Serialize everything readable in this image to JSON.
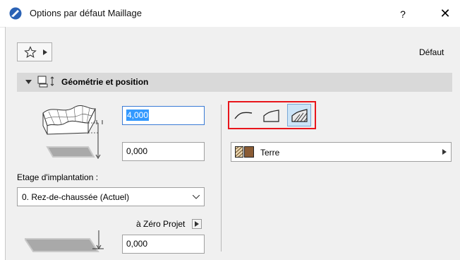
{
  "window": {
    "title": "Options par défaut Maillage",
    "help_label": "?",
    "close_label": "✕"
  },
  "toolbar": {
    "favorites_icon": "star-icon",
    "default_label": "Défaut"
  },
  "section": {
    "title": "Géométrie et position"
  },
  "geometry": {
    "height_value": "4,000",
    "bottom_value": "0,000",
    "story_label": "Etage d'implantation :",
    "story_selected": "0. Rez-de-chaussée (Actuel)",
    "reference_label": "à Zéro Projet",
    "reference_value": "0,000"
  },
  "structure": {
    "types": [
      "surface-only",
      "with-skirt",
      "solid-body"
    ],
    "active_type": "solid-body",
    "material_label": "Terre"
  },
  "colors": {
    "accent": "#3399ff",
    "highlight": "#e8151b",
    "section_bg": "#d9d9d9"
  }
}
